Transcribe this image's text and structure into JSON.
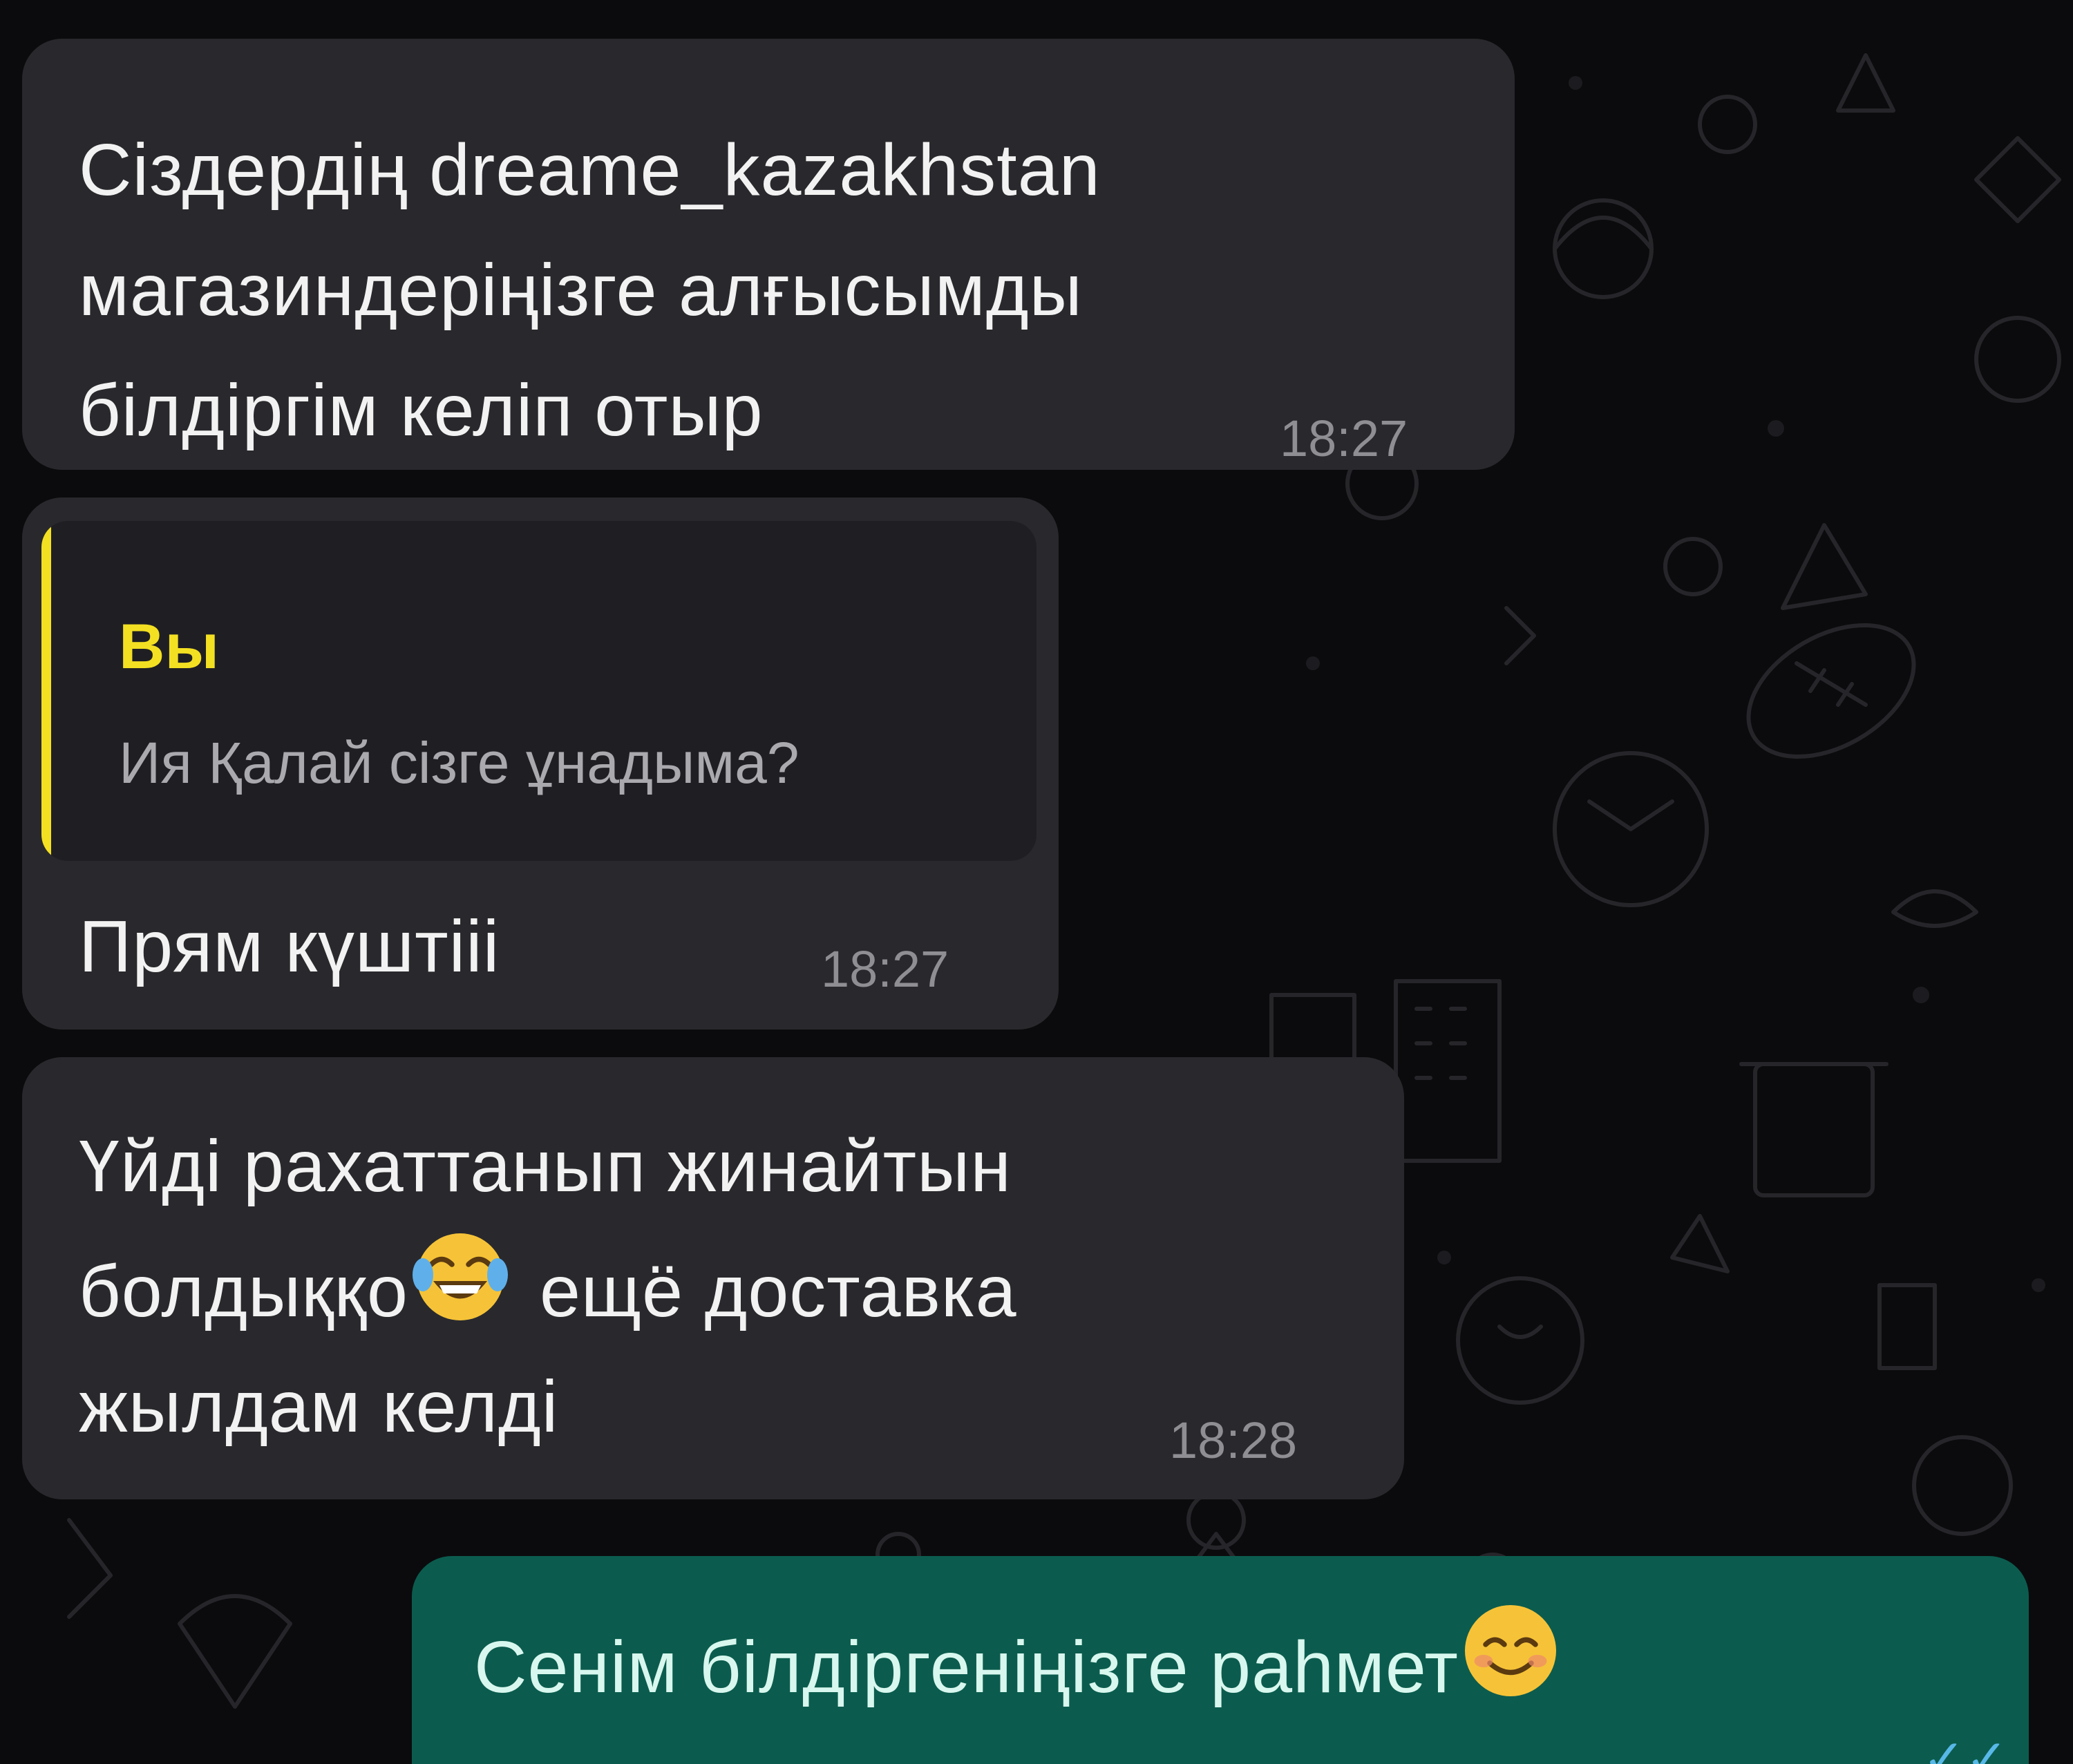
{
  "messages": [
    {
      "direction": "incoming",
      "lines": [
        "Сіздердің dreame_kazakhstan",
        "магазиндеріңізге алғысымды",
        "білдіргім келіп отыр"
      ],
      "time": "18:27"
    },
    {
      "direction": "incoming",
      "reply_to": {
        "author": "Вы",
        "text": "Ия Қалай сізге ұнадыма?"
      },
      "lines": [
        "Прям күштііі"
      ],
      "time": "18:27"
    },
    {
      "direction": "incoming",
      "lines": [
        "Үйді рахаттанып жинайтын",
        "болдыққо",
        "ещё доставка",
        "жылдам келді"
      ],
      "emoji": "face-with-tears-of-joy",
      "time": "18:28"
    },
    {
      "direction": "outgoing",
      "lines": [
        "Сенім білдіргеніңізге рahмет"
      ],
      "emoji": "smiling-face-with-smiling-eyes"
    }
  ],
  "colors": {
    "background": "#0b0b0d",
    "incoming_bubble": "#29292d",
    "outgoing_bubble": "#0b5c4e",
    "reply_accent": "#f4e022",
    "timestamp": "#8e8e93"
  }
}
